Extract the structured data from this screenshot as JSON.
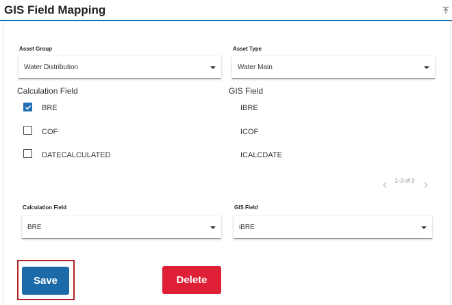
{
  "title": "GIS Field Mapping",
  "icons": {
    "collapse": "collapse-up-icon",
    "checkbox_checked": "check-icon",
    "prev": "chevron-left-icon",
    "next": "chevron-right-icon",
    "dropdown": "caret-down-icon"
  },
  "asset_group": {
    "label": "Asset Group",
    "value": "Water Distribution"
  },
  "asset_type": {
    "label": "Asset Type",
    "value": "Water Main"
  },
  "mapping_table": {
    "headers": {
      "calc": "Calculation Field",
      "gis": "GIS Field"
    },
    "rows": [
      {
        "calc": "BRE",
        "gis": "IBRE",
        "checked": true
      },
      {
        "calc": "COF",
        "gis": "ICOF",
        "checked": false
      },
      {
        "calc": "DATECALCULATED",
        "gis": "ICALCDATE",
        "checked": false
      }
    ],
    "pagination": "1–3 of 3"
  },
  "calc_field_select": {
    "label": "Calculation Field",
    "value": "BRE"
  },
  "gis_field_select": {
    "label": "GIS Field",
    "value": "iBRE"
  },
  "buttons": {
    "save": "Save",
    "delete": "Delete"
  },
  "colors": {
    "accent": "#1f6fb5",
    "save": "#1c6aa8",
    "delete": "#de1f35",
    "highlight": "#b02020"
  }
}
